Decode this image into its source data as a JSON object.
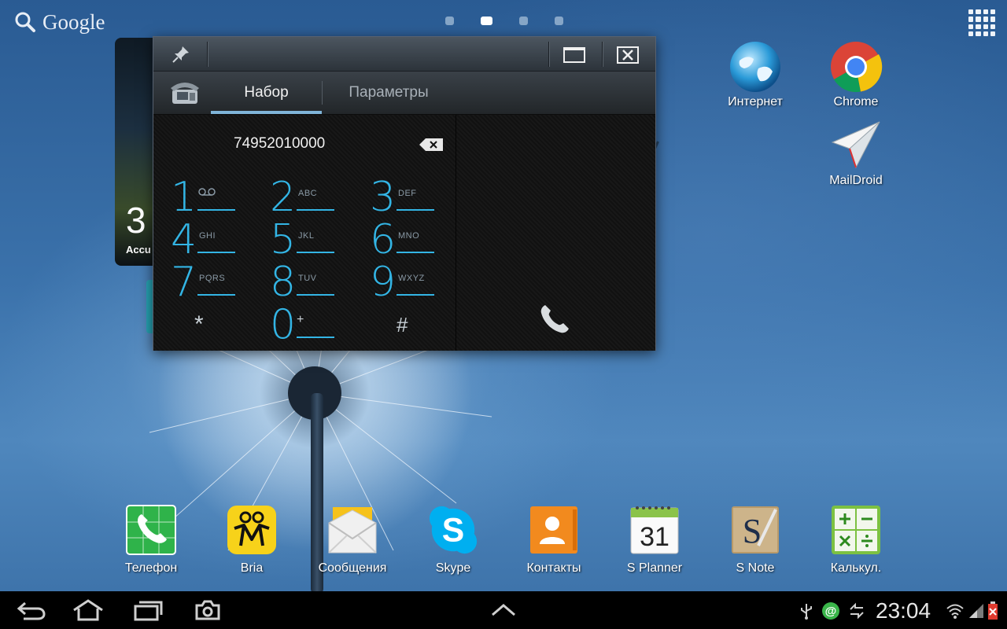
{
  "search": {
    "label": "Google"
  },
  "dialer": {
    "tabs": [
      {
        "label": "Набор"
      },
      {
        "label": "Параметры"
      }
    ],
    "number": "74952010000",
    "keys": [
      {
        "digit": "1",
        "letters": ""
      },
      {
        "digit": "2",
        "letters": "ABC"
      },
      {
        "digit": "3",
        "letters": "DEF"
      },
      {
        "digit": "4",
        "letters": "GHI"
      },
      {
        "digit": "5",
        "letters": "JKL"
      },
      {
        "digit": "6",
        "letters": "MNO"
      },
      {
        "digit": "7",
        "letters": "PQRS"
      },
      {
        "digit": "8",
        "letters": "TUV"
      },
      {
        "digit": "9",
        "letters": "WXYZ"
      },
      {
        "digit": "*",
        "letters": ""
      },
      {
        "digit": "0",
        "letters": "+"
      },
      {
        "digit": "#",
        "letters": ""
      }
    ],
    "accent_color": "#33b5e5"
  },
  "widget": {
    "time": "3",
    "place": "Accu"
  },
  "desktop_icons": [
    {
      "label": "Интернет",
      "icon": "globe-icon"
    },
    {
      "label": "Chrome",
      "icon": "chrome-icon"
    },
    {
      "label": "MailDroid",
      "icon": "paper-plane-icon"
    }
  ],
  "dock": [
    {
      "label": "Телефон",
      "icon": "phone-icon"
    },
    {
      "label": "Bria",
      "icon": "bria-icon"
    },
    {
      "label": "Сообщения",
      "icon": "envelope-icon"
    },
    {
      "label": "Skype",
      "icon": "skype-icon"
    },
    {
      "label": "Контакты",
      "icon": "contacts-icon"
    },
    {
      "label": "S Planner",
      "icon": "calendar-icon",
      "day": "31"
    },
    {
      "label": "S Note",
      "icon": "s-note-icon",
      "letter": "S"
    },
    {
      "label": "Калькул.",
      "icon": "calculator-icon"
    }
  ],
  "status": {
    "time": "23:04"
  }
}
